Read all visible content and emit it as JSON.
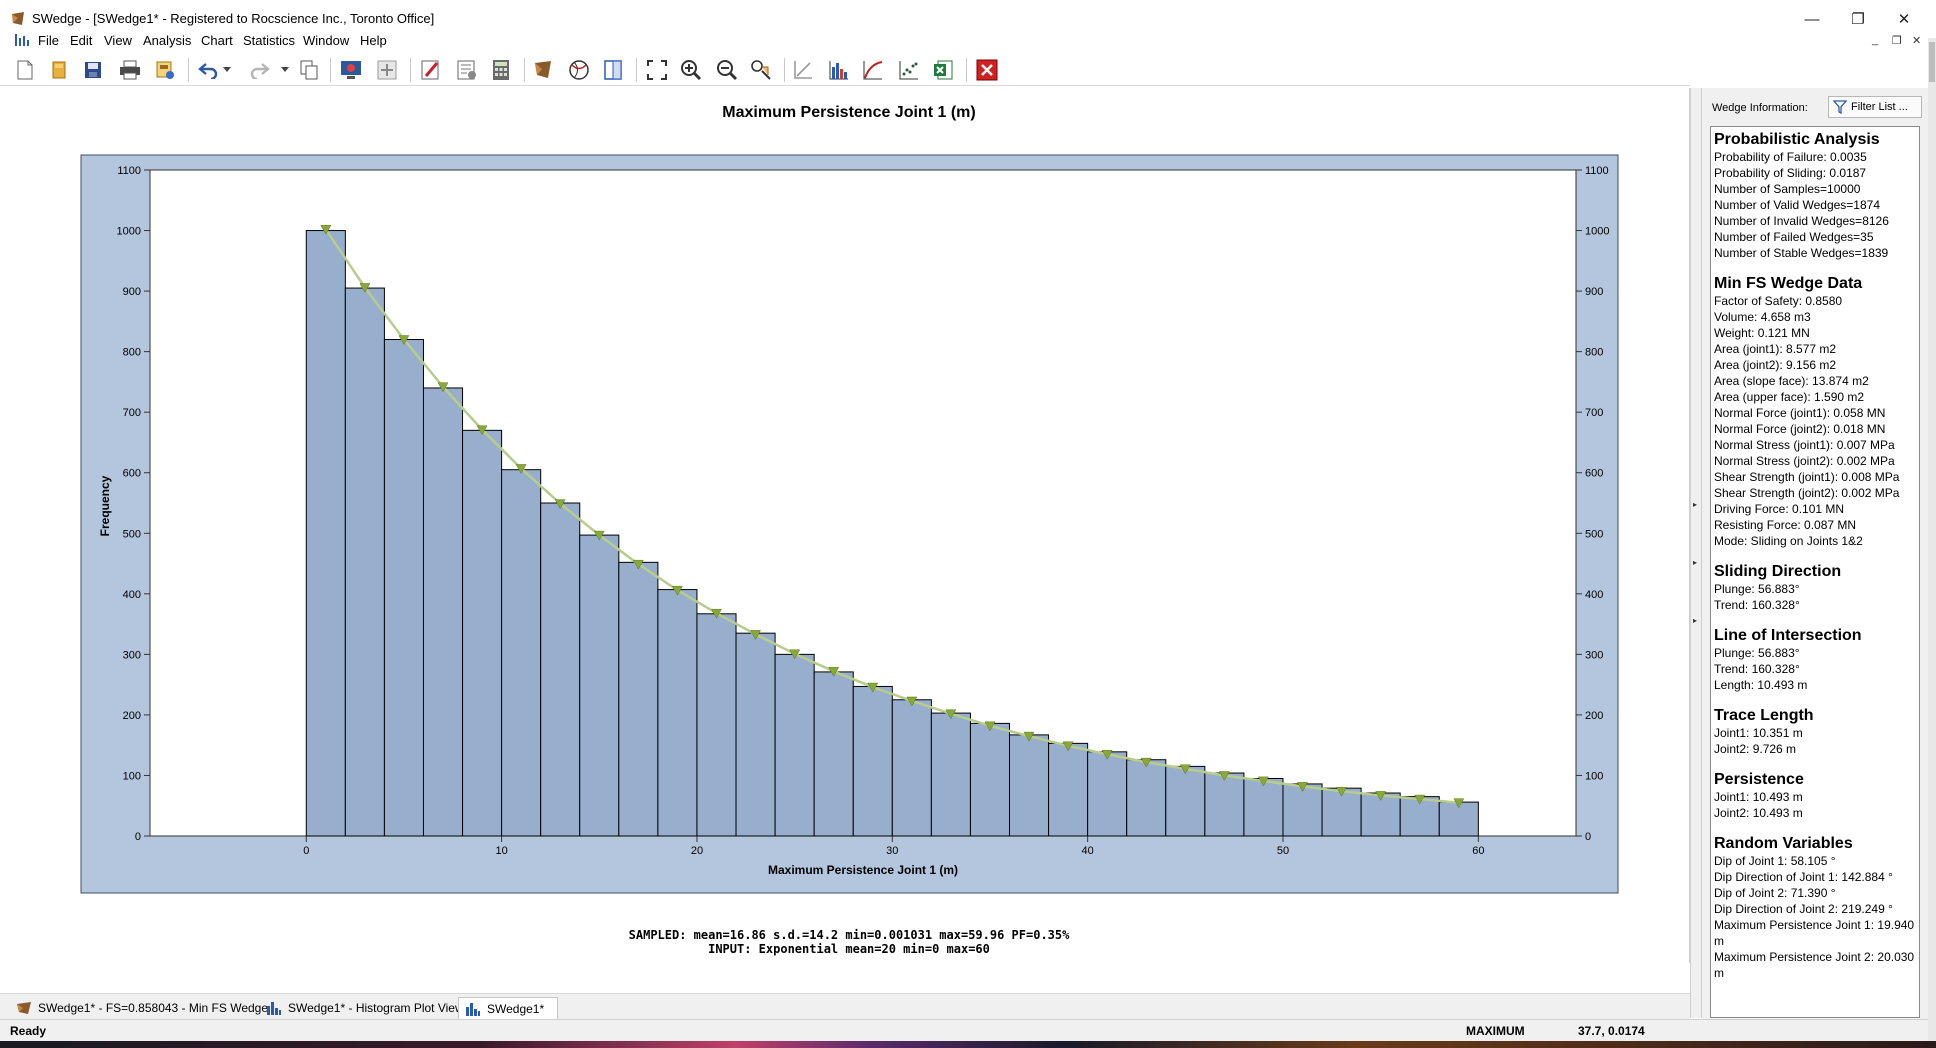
{
  "window": {
    "title": "SWedge - [SWedge1* - Registered to Rocscience Inc., Toronto Office]",
    "minimize_glyph": "—",
    "maximize_glyph": "❐",
    "close_glyph": "✕"
  },
  "menu": {
    "items": [
      "File",
      "Edit",
      "View",
      "Analysis",
      "Chart",
      "Statistics",
      "Window",
      "Help"
    ]
  },
  "toolbar": {
    "icons": [
      "new-icon",
      "open-icon",
      "save-icon",
      "print-icon",
      "export-image-icon",
      "undo-icon",
      "undo-dropdown-icon",
      "redo-icon",
      "redo-dropdown-icon",
      "copy-icon",
      "model-view-icon",
      "add-joint-icon",
      "edit-icon",
      "properties-icon",
      "calculator-icon",
      "wedge-icon",
      "stereonet-icon",
      "sidebar-icon",
      "zoom-extents-icon",
      "zoom-in-icon",
      "zoom-out-icon",
      "pan-icon",
      "axes-icon",
      "histogram-icon",
      "cumulative-icon",
      "scatter-icon",
      "excel-icon",
      "close-red-icon"
    ]
  },
  "chart_data": {
    "type": "bar",
    "title": "Maximum Persistence Joint 1 (m)",
    "xlabel": "Maximum Persistence Joint 1 (m)",
    "ylabel": "Frequency",
    "xlim": [
      -8,
      65
    ],
    "ylim": [
      0,
      1100
    ],
    "xticks": [
      0,
      10,
      20,
      30,
      40,
      50,
      60
    ],
    "yticks": [
      0,
      100,
      200,
      300,
      400,
      500,
      600,
      700,
      800,
      900,
      1000,
      1100
    ],
    "bin_width": 2,
    "bin_starts": [
      0,
      2,
      4,
      6,
      8,
      10,
      12,
      14,
      16,
      18,
      20,
      22,
      24,
      26,
      28,
      30,
      32,
      34,
      36,
      38,
      40,
      42,
      44,
      46,
      48,
      50,
      52,
      54,
      56,
      58
    ],
    "values": [
      1000,
      905,
      820,
      740,
      670,
      605,
      550,
      497,
      452,
      407,
      367,
      335,
      300,
      271,
      247,
      225,
      203,
      186,
      167,
      153,
      139,
      126,
      115,
      104,
      95,
      86,
      79,
      71,
      65,
      56
    ],
    "fit_curve": {
      "distribution": "Exponential",
      "x": [
        1,
        3,
        5,
        7,
        9,
        11,
        13,
        15,
        17,
        19,
        21,
        23,
        25,
        27,
        29,
        31,
        33,
        35,
        37,
        39,
        41,
        43,
        45,
        47,
        49,
        51,
        53,
        55,
        57,
        59
      ],
      "y": [
        1002,
        906,
        820,
        742,
        671,
        607,
        549,
        497,
        449,
        406,
        368,
        333,
        301,
        272,
        246,
        223,
        202,
        182,
        165,
        149,
        135,
        122,
        111,
        100,
        91,
        82,
        74,
        67,
        61,
        55
      ]
    },
    "colors": {
      "bar_fill": "#97afcd",
      "bar_stroke": "#000000",
      "plot_border_bg": "#b4c6dd",
      "curve": "#b8cc8c",
      "curve_marker": "#8aa83a"
    },
    "grid": false,
    "legend": "none"
  },
  "footer": {
    "sampled": "SAMPLED: mean=16.86 s.d.=14.2 min=0.001031 max=59.96 PF=0.35%",
    "input": "INPUT: Exponential mean=20 min=0 max=60"
  },
  "info_panel": {
    "header_label": "Wedge Information:",
    "filter_button": "Filter List ...",
    "sections": [
      {
        "title": "Probabilistic Analysis",
        "lines": [
          "Probability of Failure: 0.0035",
          "Probability of Sliding: 0.0187",
          "Number of Samples=10000",
          "Number of Valid Wedges=1874",
          "Number of Invalid Wedges=8126",
          "Number of Failed Wedges=35",
          "Number of Stable Wedges=1839"
        ]
      },
      {
        "title": "Min FS Wedge Data",
        "lines": [
          "Factor of Safety: 0.8580",
          "Volume: 4.658 m3",
          "Weight: 0.121 MN",
          "Area (joint1): 8.577 m2",
          "Area (joint2): 9.156 m2",
          "Area (slope face): 13.874 m2",
          "Area (upper face): 1.590 m2",
          "Normal Force (joint1): 0.058 MN",
          "Normal Force (joint2): 0.018 MN",
          "Normal Stress (joint1): 0.007 MPa",
          "Normal Stress (joint2): 0.002 MPa",
          "Shear Strength (joint1): 0.008 MPa",
          "Shear Strength (joint2): 0.002 MPa",
          "Driving Force: 0.101 MN",
          "Resisting Force: 0.087 MN",
          "Mode: Sliding on Joints 1&2"
        ]
      },
      {
        "title": "Sliding Direction",
        "lines": [
          "Plunge: 56.883°",
          "Trend: 160.328°"
        ]
      },
      {
        "title": "Line of Intersection",
        "lines": [
          "Plunge: 56.883°",
          "Trend: 160.328°",
          "Length: 10.493 m"
        ]
      },
      {
        "title": "Trace Length",
        "lines": [
          "Joint1: 10.351 m",
          "Joint2: 9.726 m"
        ]
      },
      {
        "title": "Persistence",
        "lines": [
          "Joint1: 10.493 m",
          "Joint2: 10.493 m"
        ]
      },
      {
        "title": "Random Variables",
        "lines": [
          "Dip of Joint 1: 58.105 °",
          "Dip Direction of Joint 1: 142.884 °",
          "Dip of Joint 2: 71.390 °",
          "Dip Direction of Joint 2: 219.249 °",
          "Maximum Persistence Joint 1: 19.940 m",
          "Maximum Persistence Joint 2: 20.030 m"
        ]
      }
    ]
  },
  "tabs": [
    {
      "label": "SWedge1* - FS=0.858043 - Min FS Wedge",
      "icon": "wedge-icon"
    },
    {
      "label": "SWedge1* - Histogram Plot View",
      "icon": "histogram-icon"
    },
    {
      "label": "SWedge1*",
      "icon": "histogram-icon"
    }
  ],
  "status": {
    "ready": "Ready",
    "mode": "MAXIMUM",
    "coords": "37.7, 0.0174"
  }
}
